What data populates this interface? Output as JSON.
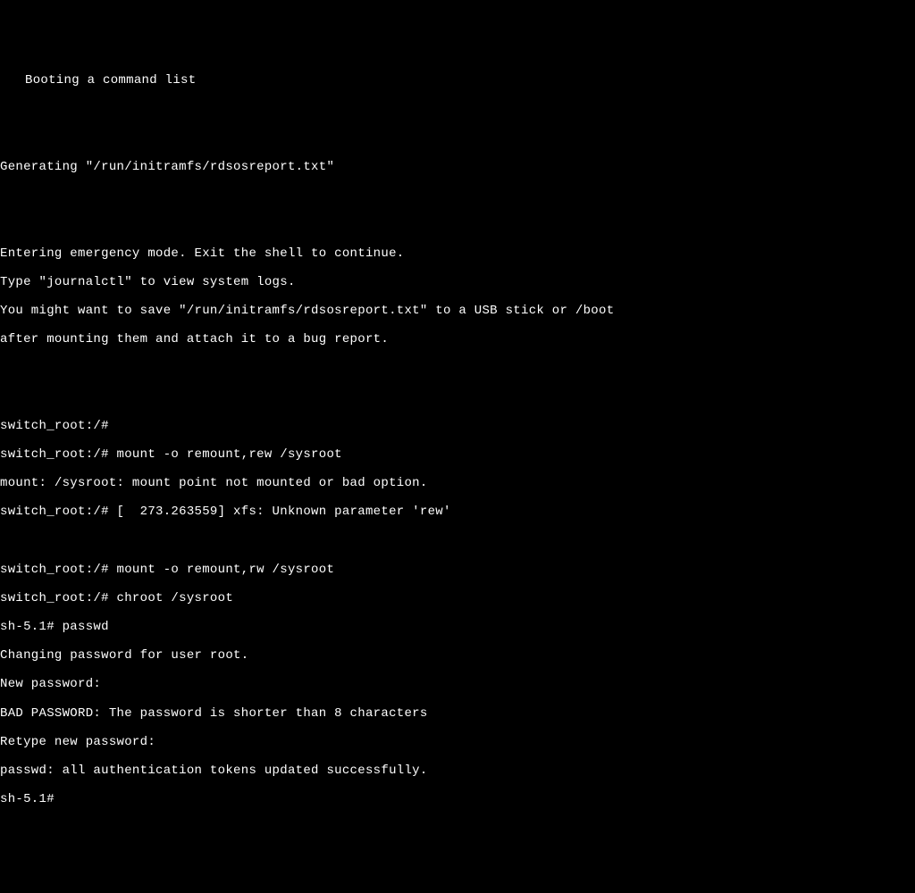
{
  "terminal": {
    "lines": {
      "l0": "Booting a command list",
      "l1": "",
      "l2": "",
      "l3": "Generating \"/run/initramfs/rdsosreport.txt\"",
      "l4": "",
      "l5": "",
      "l6": "Entering emergency mode. Exit the shell to continue.",
      "l7": "Type \"journalctl\" to view system logs.",
      "l8": "You might want to save \"/run/initramfs/rdsosreport.txt\" to a USB stick or /boot",
      "l9": "after mounting them and attach it to a bug report.",
      "l10": "",
      "l11": "",
      "l12": "switch_root:/#",
      "l13": "switch_root:/# mount -o remount,rew /sysroot",
      "l14": "mount: /sysroot: mount point not mounted or bad option.",
      "l15": "switch_root:/# [  273.263559] xfs: Unknown parameter 'rew'",
      "l16": "",
      "l17": "switch_root:/# mount -o remount,rw /sysroot",
      "l18": "switch_root:/# chroot /sysroot",
      "l19": "sh-5.1# passwd",
      "l20": "Changing password for user root.",
      "l21": "New password:",
      "l22": "BAD PASSWORD: The password is shorter than 8 characters",
      "l23": "Retype new password:",
      "l24": "passwd: all authentication tokens updated successfully.",
      "l25": "sh-5.1# "
    }
  }
}
